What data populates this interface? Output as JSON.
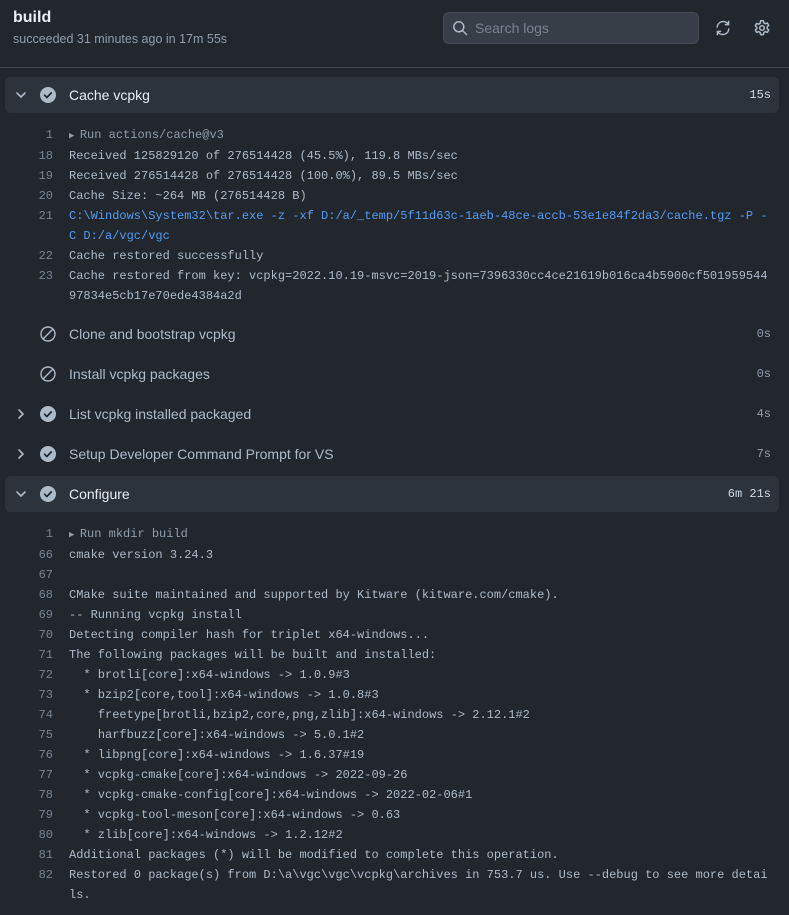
{
  "job": {
    "title": "build",
    "status": "succeeded 31 minutes ago in 17m 55s"
  },
  "search": {
    "placeholder": "Search logs",
    "value": ""
  },
  "icons": {
    "search": "search-icon",
    "refresh": "sync-icon",
    "settings": "gear-icon",
    "success": "check-circle-icon",
    "skipped": "skip-circle-icon",
    "expand": "chevron-right-icon",
    "collapse": "chevron-down-icon"
  },
  "colors": {
    "background": "#22272e",
    "expanded_row": "#2d333b",
    "command_text": "#539bf5",
    "check_fill": "#adbac7"
  },
  "steps": [
    {
      "name": "Cache vcpkg",
      "duration": "15s",
      "state": "success",
      "expanded": true,
      "lines": [
        {
          "n": "1",
          "text": "Run actions/cache@v3",
          "kind": "group"
        },
        {
          "n": "18",
          "text": "Received 125829120 of 276514428 (45.5%), 119.8 MBs/sec",
          "kind": "normal"
        },
        {
          "n": "19",
          "text": "Received 276514428 of 276514428 (100.0%), 89.5 MBs/sec",
          "kind": "normal"
        },
        {
          "n": "20",
          "text": "Cache Size: ~264 MB (276514428 B)",
          "kind": "normal"
        },
        {
          "n": "21",
          "text": "C:\\Windows\\System32\\tar.exe -z -xf D:/a/_temp/5f11d63c-1aeb-48ce-accb-53e1e84f2da3/cache.tgz -P -C D:/a/vgc/vgc",
          "kind": "cmd"
        },
        {
          "n": "22",
          "text": "Cache restored successfully",
          "kind": "normal"
        },
        {
          "n": "23",
          "text": "Cache restored from key: vcpkg=2022.10.19-msvc=2019-json=7396330cc4ce21619b016ca4b5900cf50195954497834e5cb17e70ede4384a2d",
          "kind": "normal"
        }
      ]
    },
    {
      "name": "Clone and bootstrap vcpkg",
      "duration": "0s",
      "state": "skipped",
      "expanded": false,
      "lines": []
    },
    {
      "name": "Install vcpkg packages",
      "duration": "0s",
      "state": "skipped",
      "expanded": false,
      "lines": []
    },
    {
      "name": "List vcpkg installed packaged",
      "duration": "4s",
      "state": "success",
      "expanded": false,
      "lines": []
    },
    {
      "name": "Setup Developer Command Prompt for VS",
      "duration": "7s",
      "state": "success",
      "expanded": false,
      "lines": []
    },
    {
      "name": "Configure",
      "duration": "6m 21s",
      "state": "success",
      "expanded": true,
      "lines": [
        {
          "n": "1",
          "text": "Run mkdir build",
          "kind": "group"
        },
        {
          "n": "66",
          "text": "cmake version 3.24.3",
          "kind": "normal"
        },
        {
          "n": "67",
          "text": "",
          "kind": "normal"
        },
        {
          "n": "68",
          "text": "CMake suite maintained and supported by Kitware (kitware.com/cmake).",
          "kind": "normal"
        },
        {
          "n": "69",
          "text": "-- Running vcpkg install",
          "kind": "normal"
        },
        {
          "n": "70",
          "text": "Detecting compiler hash for triplet x64-windows...",
          "kind": "normal"
        },
        {
          "n": "71",
          "text": "The following packages will be built and installed:",
          "kind": "normal"
        },
        {
          "n": "72",
          "text": "  * brotli[core]:x64-windows -> 1.0.9#3",
          "kind": "normal"
        },
        {
          "n": "73",
          "text": "  * bzip2[core,tool]:x64-windows -> 1.0.8#3",
          "kind": "normal"
        },
        {
          "n": "74",
          "text": "    freetype[brotli,bzip2,core,png,zlib]:x64-windows -> 2.12.1#2",
          "kind": "normal"
        },
        {
          "n": "75",
          "text": "    harfbuzz[core]:x64-windows -> 5.0.1#2",
          "kind": "normal"
        },
        {
          "n": "76",
          "text": "  * libpng[core]:x64-windows -> 1.6.37#19",
          "kind": "normal"
        },
        {
          "n": "77",
          "text": "  * vcpkg-cmake[core]:x64-windows -> 2022-09-26",
          "kind": "normal"
        },
        {
          "n": "78",
          "text": "  * vcpkg-cmake-config[core]:x64-windows -> 2022-02-06#1",
          "kind": "normal"
        },
        {
          "n": "79",
          "text": "  * vcpkg-tool-meson[core]:x64-windows -> 0.63",
          "kind": "normal"
        },
        {
          "n": "80",
          "text": "  * zlib[core]:x64-windows -> 1.2.12#2",
          "kind": "normal"
        },
        {
          "n": "81",
          "text": "Additional packages (*) will be modified to complete this operation.",
          "kind": "normal"
        },
        {
          "n": "82",
          "text": "Restored 0 package(s) from D:\\a\\vgc\\vgc\\vcpkg\\archives in 753.7 us. Use --debug to see more details.",
          "kind": "normal"
        }
      ]
    }
  ]
}
